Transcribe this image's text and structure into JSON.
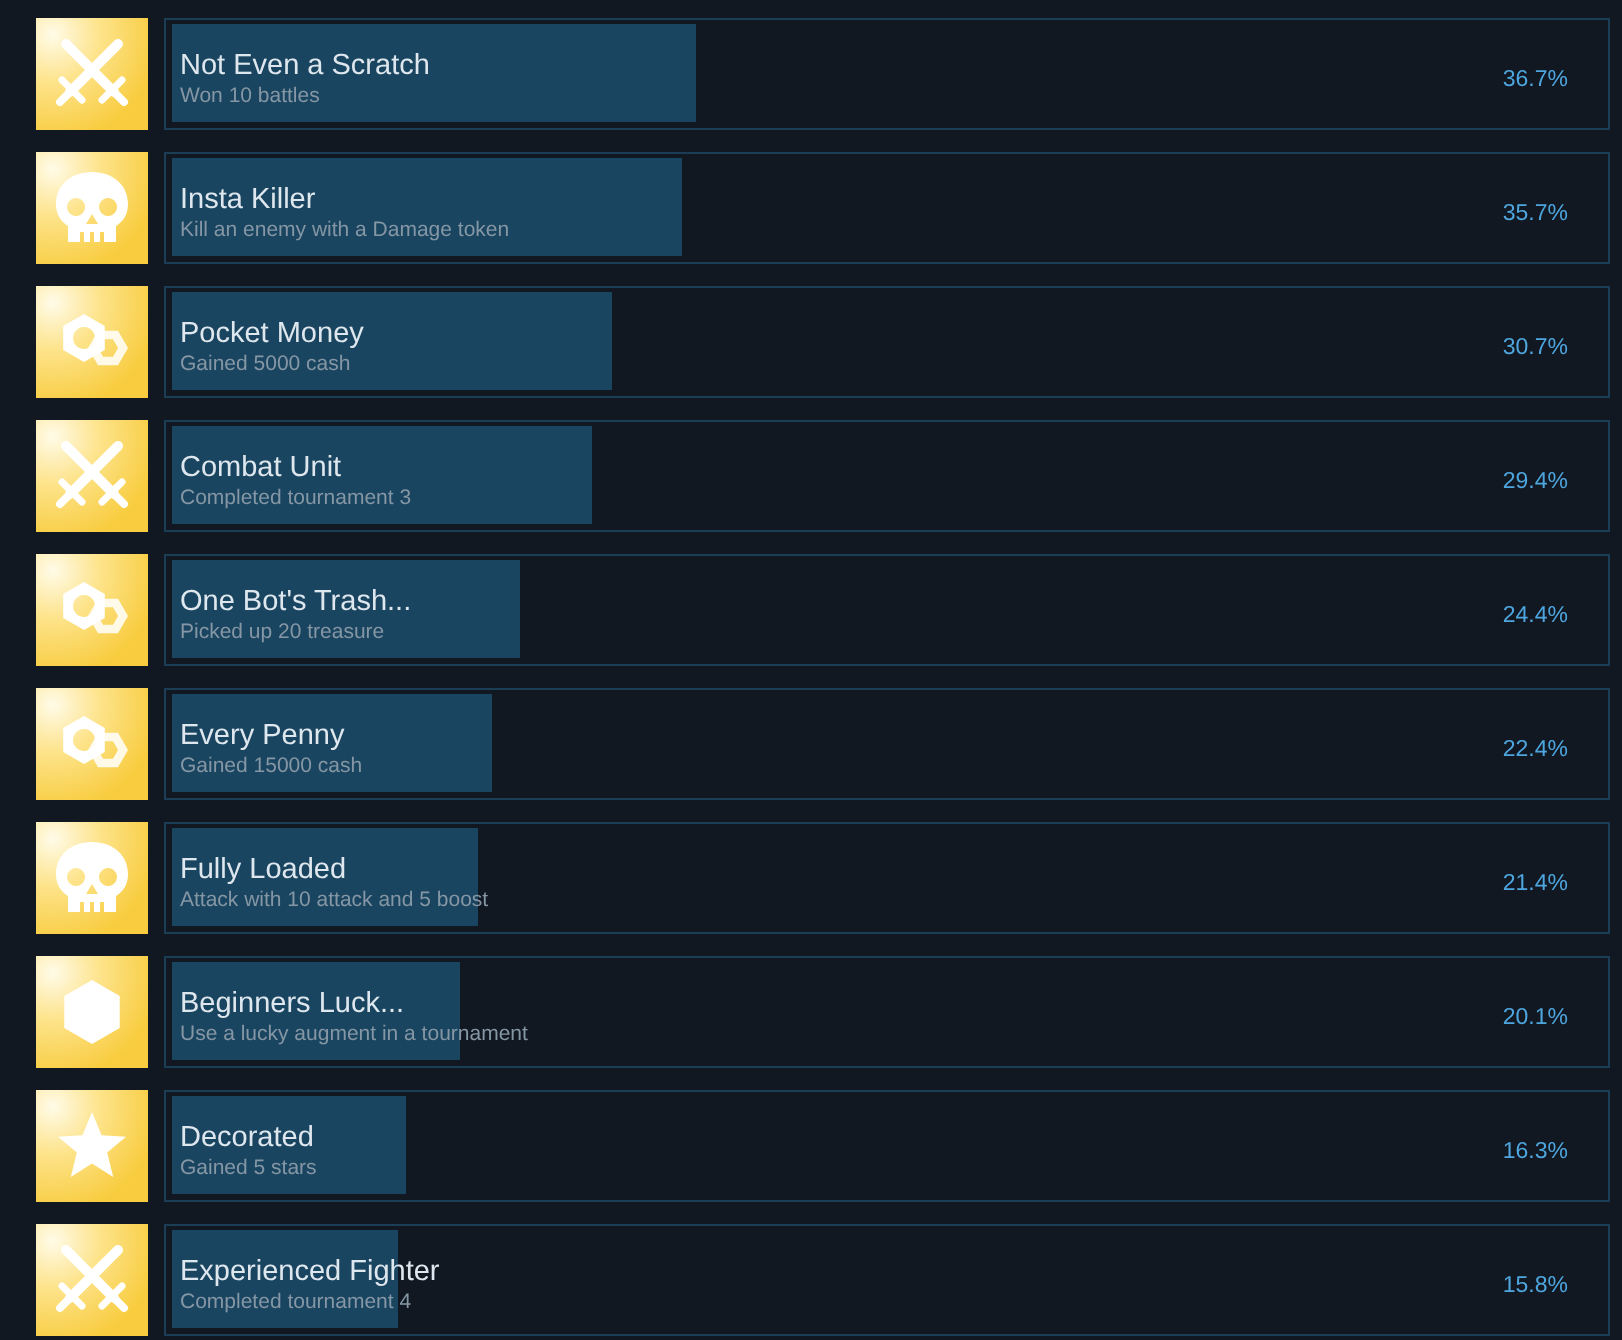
{
  "achievements": [
    {
      "kind": "swords",
      "title": "Not Even a Scratch",
      "description": "Won 10 battles",
      "percentage": "36.7%",
      "level": 0.367
    },
    {
      "kind": "skull",
      "title": "Insta Killer",
      "description": "Kill an enemy with a Damage token",
      "percentage": "35.7%",
      "level": 0.357
    },
    {
      "kind": "nuts",
      "title": "Pocket Money",
      "description": "Gained 5000 cash",
      "percentage": "30.7%",
      "level": 0.307
    },
    {
      "kind": "swords",
      "title": "Combat Unit",
      "description": "Completed tournament 3",
      "percentage": "29.4%",
      "level": 0.294
    },
    {
      "kind": "nuts",
      "title": "One Bot's Trash...",
      "description": "Picked up 20 treasure",
      "percentage": "24.4%",
      "level": 0.244
    },
    {
      "kind": "nuts",
      "title": "Every Penny",
      "description": "Gained 15000 cash",
      "percentage": "22.4%",
      "level": 0.224
    },
    {
      "kind": "skull",
      "title": "Fully Loaded",
      "description": "Attack with 10 attack and 5 boost",
      "percentage": "21.4%",
      "level": 0.214
    },
    {
      "kind": "hexagon",
      "title": "Beginners Luck...",
      "description": "Use a lucky augment in a tournament",
      "percentage": "20.1%",
      "level": 0.201
    },
    {
      "kind": "star",
      "title": "Decorated",
      "description": "Gained 5 stars",
      "percentage": "16.3%",
      "level": 0.163
    },
    {
      "kind": "swords",
      "title": "Experienced Fighter",
      "description": "Completed tournament 4",
      "percentage": "15.8%",
      "level": 0.158
    }
  ]
}
